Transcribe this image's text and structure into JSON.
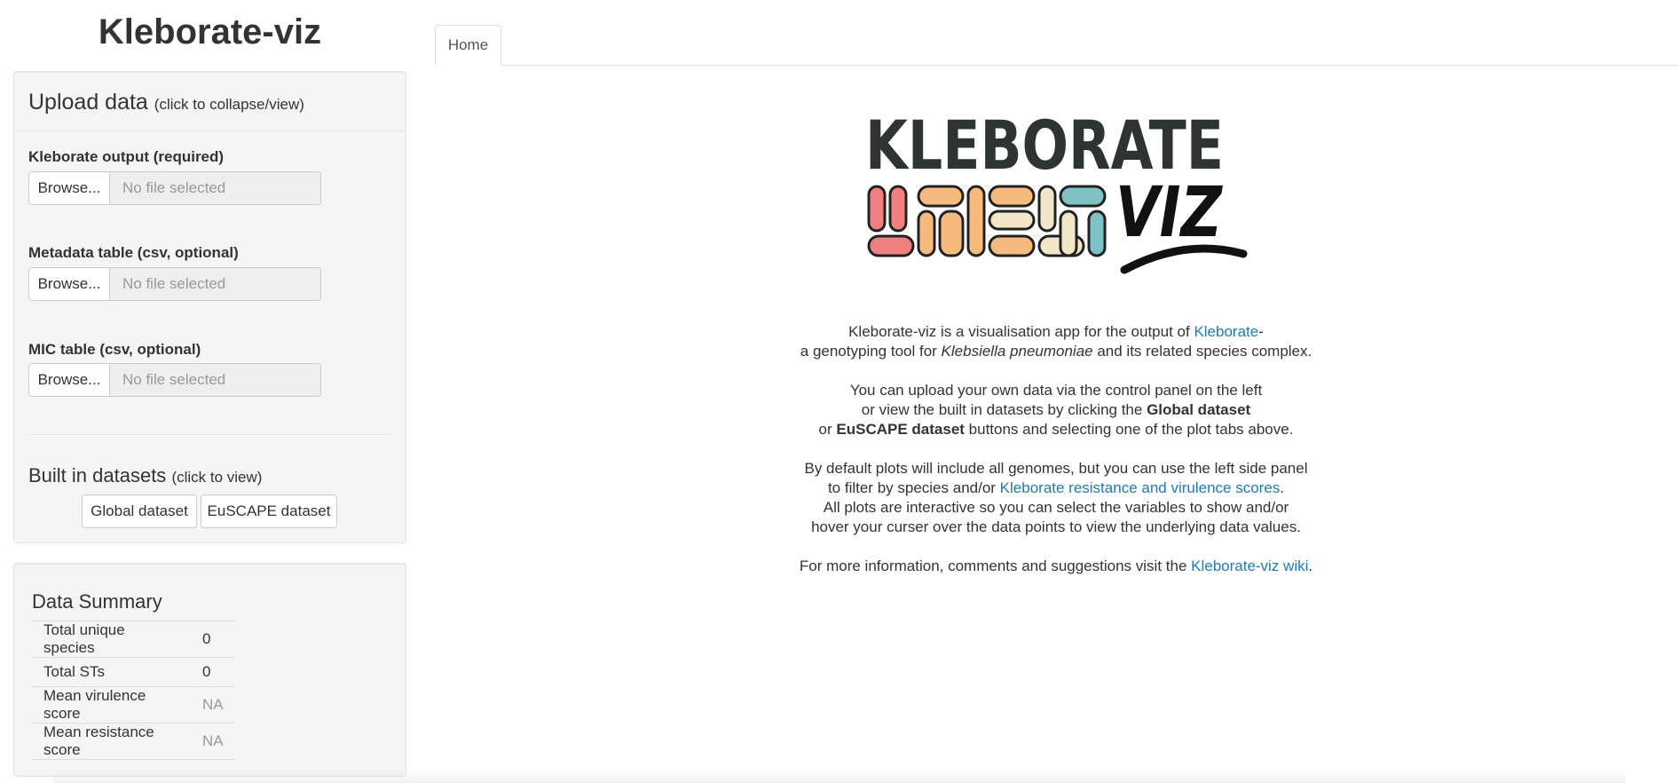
{
  "app": {
    "title": "Kleborate-viz"
  },
  "upload": {
    "heading": "Upload data",
    "heading_hint": "(click to collapse/view)",
    "fields": [
      {
        "label": "Kleborate output (required)",
        "button": "Browse...",
        "value": "No file selected"
      },
      {
        "label": "Metadata table (csv, optional)",
        "button": "Browse...",
        "value": "No file selected"
      },
      {
        "label": "MIC table (csv, optional)",
        "button": "Browse...",
        "value": "No file selected"
      }
    ]
  },
  "builtin": {
    "heading": "Built in datasets",
    "heading_hint": "(click to view)",
    "global_label": "Global dataset",
    "euscape_label": "EuSCAPE dataset"
  },
  "summary": {
    "title": "Data Summary",
    "rows": [
      {
        "label": "Total unique species",
        "value": "0"
      },
      {
        "label": "Total STs",
        "value": "0"
      },
      {
        "label": "Mean virulence score",
        "value": "NA"
      },
      {
        "label": "Mean resistance score",
        "value": "NA"
      }
    ]
  },
  "tabs": [
    {
      "label": "Home"
    }
  ],
  "logo": {
    "word": "KLEBORATE",
    "sub": "VIZ",
    "colors": [
      "#f08080",
      "#f6b97e",
      "#f2e6c8",
      "#7ec2c6",
      "#2e3434"
    ]
  },
  "home": {
    "p1": {
      "t1": "Kleborate-viz is a visualisation app for the output of ",
      "link": "Kleborate",
      "t2": "-",
      "t3": "a genotyping tool for ",
      "italic": "Klebsiella pneumoniae",
      "t4": " and its related species complex."
    },
    "p2": {
      "line1": "You can upload your own data via the control panel on the left",
      "t1": "or view the built in datasets by clicking the ",
      "b1": "Global dataset",
      "t2": "or ",
      "b2": "EuSCAPE dataset",
      "t3": " buttons and selecting one of the plot tabs above."
    },
    "p3": {
      "line1": "By default plots will include all genomes, but you can use the left side panel",
      "t1": "to filter by species and/or ",
      "link": "Kleborate resistance and virulence scores",
      "t2": ".",
      "line3": "All plots are interactive so you can select the variables to show and/or",
      "line4": "hover your curser over the data points to view the underlying data values."
    },
    "p4": {
      "t1": "For more information, comments and suggestions visit the ",
      "link": "Kleborate-viz wiki",
      "t2": "."
    }
  }
}
